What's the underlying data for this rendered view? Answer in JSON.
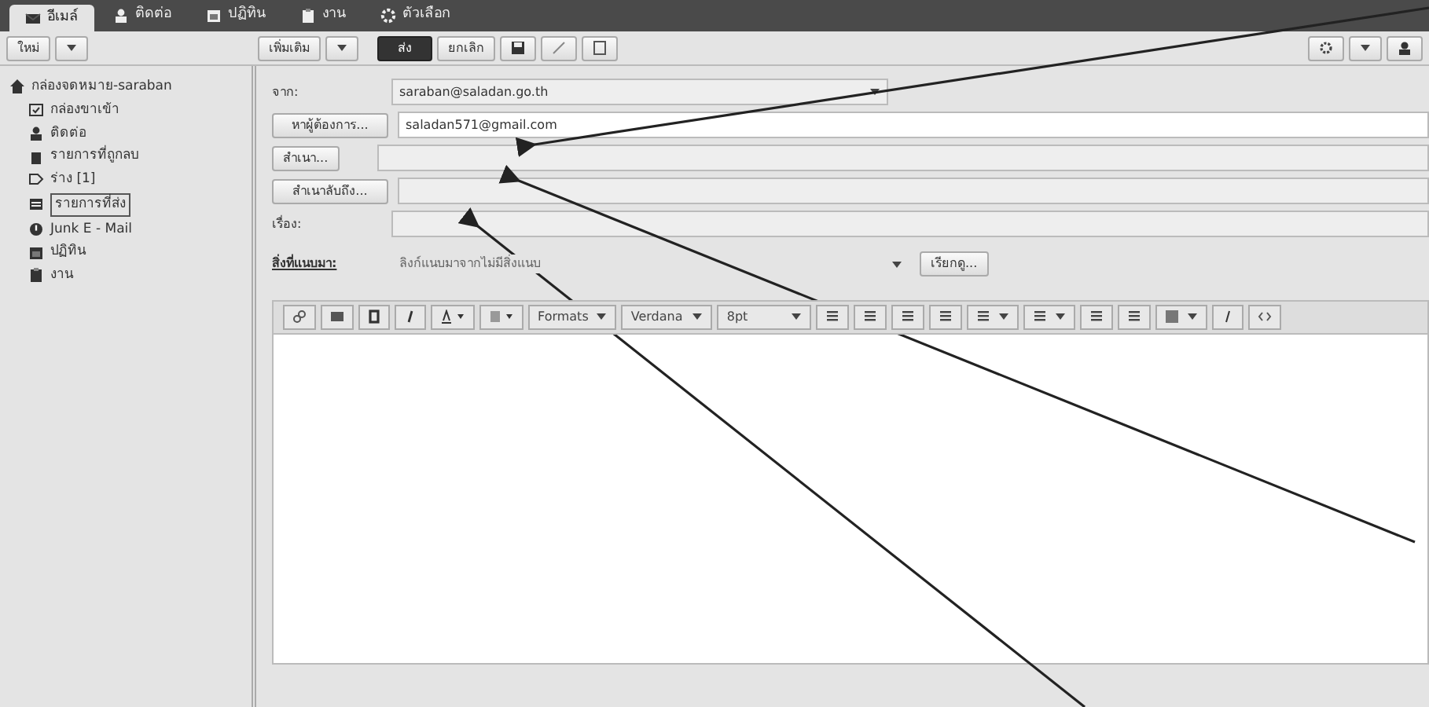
{
  "app_tabs": [
    {
      "label": "อีเมล์",
      "kind": "envelope",
      "selected": true
    },
    {
      "label": "ติดต่อ",
      "kind": "person",
      "selected": false
    },
    {
      "label": "ปฏิทิน",
      "kind": "calendar",
      "selected": false
    },
    {
      "label": "งาน",
      "kind": "clipboard",
      "selected": false
    },
    {
      "label": "ตัวเลือก",
      "kind": "gear",
      "selected": false
    }
  ],
  "toolbar": {
    "new_button": "ใหม่",
    "more_button": "เพิ่มเติม",
    "send_button": "ส่ง",
    "cancel_button": "ยกเลิก"
  },
  "sidebar": {
    "root": {
      "label": "กล่องจดหมาย-saraban",
      "children": [
        {
          "label": "กล่องขาเข้า",
          "kind": "inbox",
          "selected": false
        },
        {
          "label": "ติดต่อ",
          "kind": "person",
          "selected": false
        },
        {
          "label": "รายการที่ถูกลบ",
          "kind": "trash",
          "selected": false
        },
        {
          "label": "ร่าง [1]",
          "kind": "draft",
          "selected": false
        },
        {
          "label": "รายการที่ส่ง",
          "kind": "sent",
          "selected": true
        },
        {
          "label": "Junk E - Mail",
          "kind": "junk",
          "selected": false
        },
        {
          "label": "ปฏิทิน",
          "kind": "calendar",
          "selected": false
        },
        {
          "label": "งาน",
          "kind": "clipboard",
          "selected": false
        }
      ]
    }
  },
  "compose": {
    "from_label": "จาก:",
    "from_value": "saraban@saladan.go.th",
    "to_button": "หาผู้ต้องการ...",
    "to_value": "saladan571@gmail.com",
    "cc_button": "สำเนา...",
    "bcc_button": "สำเนาลับถึง...",
    "subject_label": "เรื่อง:",
    "attach_label": "สิ่งที่แนบมา:",
    "attach_placeholder": "ลิงก์แนบมาจากไม่มีสิ่งแนบ",
    "browse_button": "เรียกดู...",
    "editor_toolbar": {
      "format": "Formats",
      "font": "Verdana",
      "size": "8pt"
    }
  }
}
